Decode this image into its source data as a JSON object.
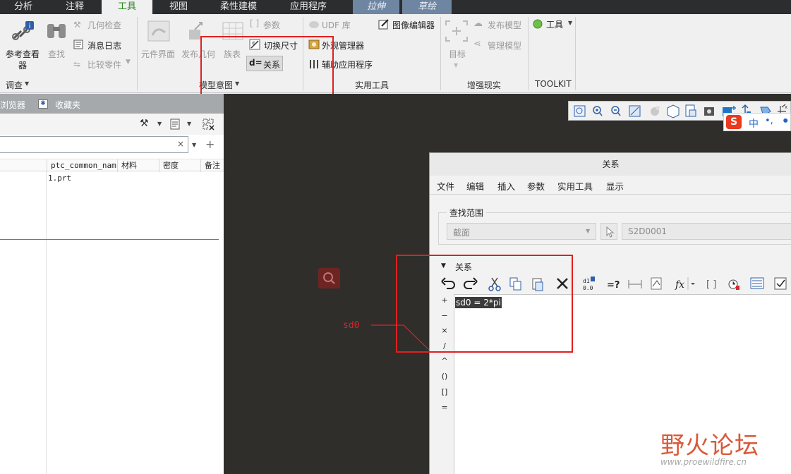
{
  "tabs": [
    {
      "label": "分析"
    },
    {
      "label": "注释"
    },
    {
      "label": "工具"
    },
    {
      "label": "视图"
    },
    {
      "label": "柔性建模"
    },
    {
      "label": "应用程序"
    },
    {
      "label": "拉伸"
    },
    {
      "label": "草绘"
    }
  ],
  "ribbon": {
    "investigate": {
      "ref_viewer_line1": "参考查看",
      "ref_viewer_line2": "器",
      "find": "查找",
      "geometry_check": "几何检查",
      "message_log": "消息日志",
      "compare_parts": "比较零件",
      "group_label": "调查"
    },
    "model_intent": {
      "component_interface": "元件界面",
      "publish_geometry": "发布几何",
      "family_table": "族表",
      "parameters": "参数",
      "switch_dimensions": "切换尺寸",
      "relations": "关系",
      "group_label": "模型意图"
    },
    "utilities": {
      "udf_library": "UDF 库",
      "image_editor": "图像编辑器",
      "appearance_manager": "外观管理器",
      "auxiliary_applications": "辅助应用程序",
      "group_label": "实用工具"
    },
    "ar": {
      "target": "目标",
      "publish_model": "发布模型",
      "manage_model": "管理模型",
      "group_label": "增强现实"
    },
    "toolkit": {
      "tools": "工具",
      "group_label": "TOOLKIT"
    }
  },
  "left_panel": {
    "tab_browser": "浏览器",
    "tab_favorites": "收藏夹",
    "columns": [
      "ptc_common_name",
      "材料",
      "密度",
      "备注"
    ],
    "rows": [
      {
        "name": "1.prt"
      }
    ]
  },
  "graphics": {
    "dimension_label": "sd0"
  },
  "ime": {
    "chinese": "中",
    "punct": "•,"
  },
  "dialog": {
    "title": "关系",
    "menu": [
      "文件",
      "编辑",
      "插入",
      "参数",
      "实用工具",
      "显示"
    ],
    "lookin_label": "查找范围",
    "lookin_value": "截面",
    "lookin_field": "S2D0001",
    "relations_label": "关系",
    "operators": [
      "+",
      "−",
      "×",
      "/",
      "^",
      "()",
      "[]",
      "="
    ],
    "relation_text": "sd0 = 2*pi"
  },
  "watermark": {
    "title": "野火论坛",
    "url": "www.proewildfire.cn"
  },
  "colors": {
    "accent_green": "#2a8a1e",
    "highlight_red": "#e21f1f",
    "graphics_bg": "#302e2b"
  }
}
